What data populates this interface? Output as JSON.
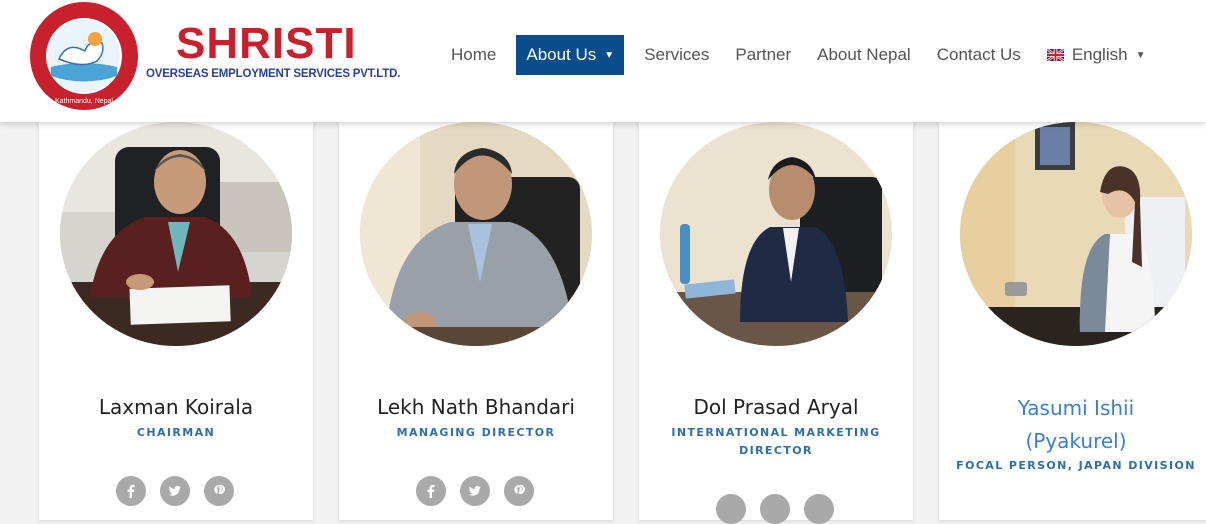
{
  "brand": {
    "name": "SHRISTI",
    "subtitle": "OVERSEAS EMPLOYMENT SERVICES PVT.LTD.",
    "seal_text": "Shristi Overseas Employment Services Pvt. Ltd.",
    "seal_location": "Kathmandu, Nepal"
  },
  "nav": {
    "items": [
      "Home",
      "About Us",
      "Services",
      "Partner",
      "About Nepal",
      "Contact Us"
    ],
    "active": "About Us",
    "language": "English"
  },
  "team": [
    {
      "name": "Laxman Koirala",
      "role": "CHAIRMAN"
    },
    {
      "name": "Lekh Nath Bhandari",
      "role": "MANAGING DIRECTOR"
    },
    {
      "name": "Dol Prasad Aryal",
      "role_lines": [
        "INTERNATIONAL MARKETING",
        "DIRECTOR"
      ]
    },
    {
      "name_lines": [
        "Yasumi Ishii",
        "(Pyakurel)"
      ],
      "role": "FOCAL PERSON, JAPAN DIVISION"
    }
  ],
  "social_icons": [
    "facebook-icon",
    "twitter-icon",
    "pinterest-icon"
  ],
  "colors": {
    "brand_red": "#c8202c",
    "brand_blue": "#2c3f9a",
    "nav_active": "#0a4d8c",
    "role_text": "#2f6fa8",
    "name_link": "#3b7fd4"
  }
}
